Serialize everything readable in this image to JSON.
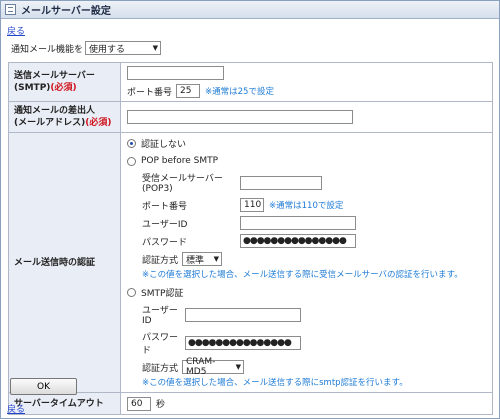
{
  "window": {
    "title": "メールサーバー設定"
  },
  "nav": {
    "back_label": "戻る"
  },
  "notify": {
    "label": "通知メール機能を",
    "value": "使用する"
  },
  "smtp_server": {
    "label_line1": "送信メールサーバー",
    "label_line2": "(SMTP)",
    "required": "(必須)",
    "value": "",
    "port_label": "ポート番号",
    "port_value": "25",
    "port_note": "※通常は25で設定"
  },
  "sender": {
    "label_line1": "通知メールの差出人",
    "label_line2": "(メールアドレス)",
    "required": "(必須)",
    "value": ""
  },
  "auth": {
    "label": "メール送信時の認証",
    "option_none": "認証しない",
    "option_pop": "POP before SMTP",
    "pop": {
      "server_label": "受信メールサーバー(POP3)",
      "server_value": "",
      "port_label": "ポート番号",
      "port_value": "110",
      "port_note": "※通常は110で設定",
      "user_label": "ユーザーID",
      "user_value": "",
      "password_label": "パスワード",
      "password_value": "●●●●●●●●●●●●●●●",
      "method_label": "認証方式",
      "method_value": "標準",
      "note": "※この値を選択した場合、メール送信する際に受信メールサーバの認証を行います。"
    },
    "option_smtp": "SMTP認証",
    "smtp": {
      "user_label": "ユーザーID",
      "user_value": "",
      "password_label": "パスワード",
      "password_value": "●●●●●●●●●●●●●●●",
      "method_label": "認証方式",
      "method_value": "CRAM-MD5",
      "note": "※この値を選択した場合、メール送信する際にsmtp認証を行います。"
    }
  },
  "timeout": {
    "label": "サーバータイムアウト",
    "value": "60",
    "unit": "秒"
  },
  "ok_button": {
    "label": "OK"
  }
}
